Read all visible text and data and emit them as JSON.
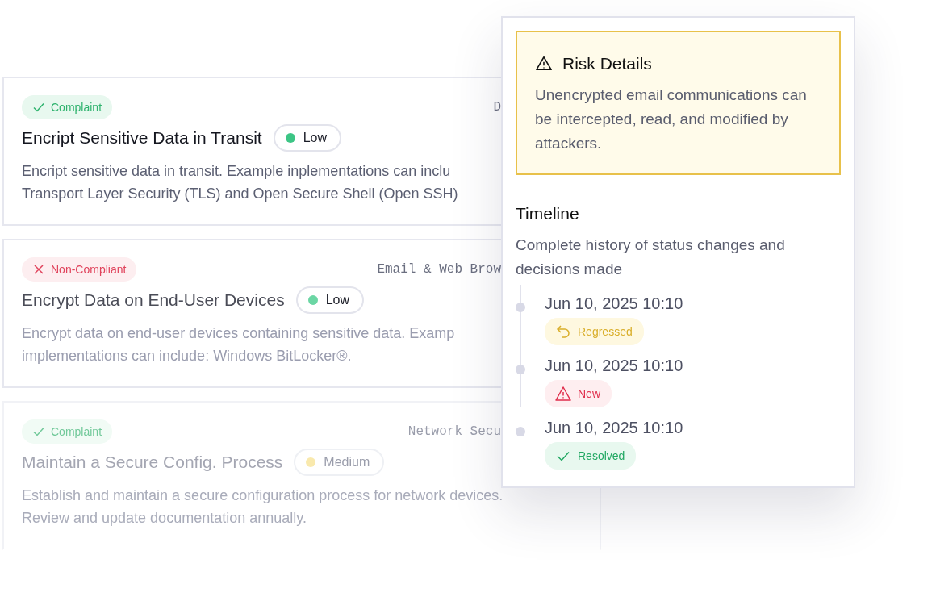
{
  "controls": [
    {
      "status": {
        "kind": "compliant",
        "label": "Complaint"
      },
      "category": "D",
      "title": "Encript Sensitive Data in Transit",
      "severity": {
        "label": "Low",
        "color": "#3cc585"
      },
      "muted": false,
      "faded": false,
      "description": [
        "Encript sensitive data in transit. Example inplementations can inclu",
        "Transport Layer Security (TLS) and Open Secure Shell (Open SSH)"
      ]
    },
    {
      "status": {
        "kind": "non_compliant",
        "label": "Non-Compliant"
      },
      "category": "Email & Web Brow",
      "title": "Encrypt Data on End-User Devices",
      "severity": {
        "label": "Low",
        "color": "#6bd6a4"
      },
      "muted": true,
      "faded": false,
      "description": [
        "Encrypt data on end-user devices containing sensitive data. Examp",
        "implementations can include: Windows BitLocker®."
      ]
    },
    {
      "status": {
        "kind": "compliant",
        "label": "Complaint"
      },
      "category": "Network Secu",
      "title": "Maintain a Secure Config. Process",
      "severity": {
        "label": "Medium",
        "color": "#f9e9ad"
      },
      "muted": true,
      "faded": true,
      "description": [
        "Establish and maintain a secure configuration process for network devices.",
        "Review and update documentation annually."
      ]
    }
  ],
  "details": {
    "risk": {
      "title": "Risk Details",
      "text": "Unencrypted email communications can be intercepted, read, and modified by attackers."
    },
    "timeline": {
      "title": "Timeline",
      "subtitle": "Complete history of status changes and decisions made",
      "events": [
        {
          "date": "Jun 10, 2025 10:10",
          "kind": "regressed",
          "label": "Regressed"
        },
        {
          "date": "Jun 10, 2025 10:10",
          "kind": "new",
          "label": "New"
        },
        {
          "date": "Jun 10, 2025 10:10",
          "kind": "resolved",
          "label": "Resolved"
        }
      ]
    }
  }
}
